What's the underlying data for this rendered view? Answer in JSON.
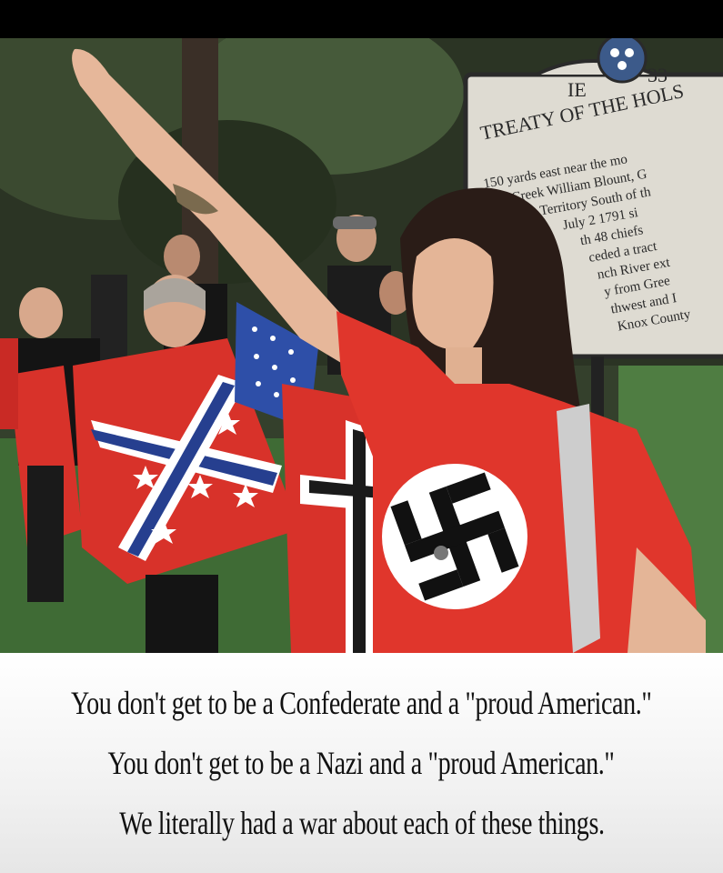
{
  "marker": {
    "number": "33",
    "region": "IE",
    "title": "TREATY OF THE HOLS",
    "lines": [
      "150 yards east near the mo",
      "Creek William Blount, G",
      "Territory South of th",
      "July 2 1791 si",
      "th 48 chiefs",
      "ceded a tract",
      "nch River ext",
      "y from Gree",
      "thwest and I",
      "Knox County"
    ]
  },
  "caption": {
    "lines": [
      "You don't get to be a Confederate and a \"proud American.\"",
      "You don't get to be a Nazi and a \"proud American.\"",
      "We literally had a war about each of these things."
    ]
  },
  "colors": {
    "shirt_red": "#e0362c",
    "flag_red": "#d8322a",
    "flag_blue": "#263f8f",
    "grass": "#3f6b35",
    "foliage": "#2d3a26"
  }
}
